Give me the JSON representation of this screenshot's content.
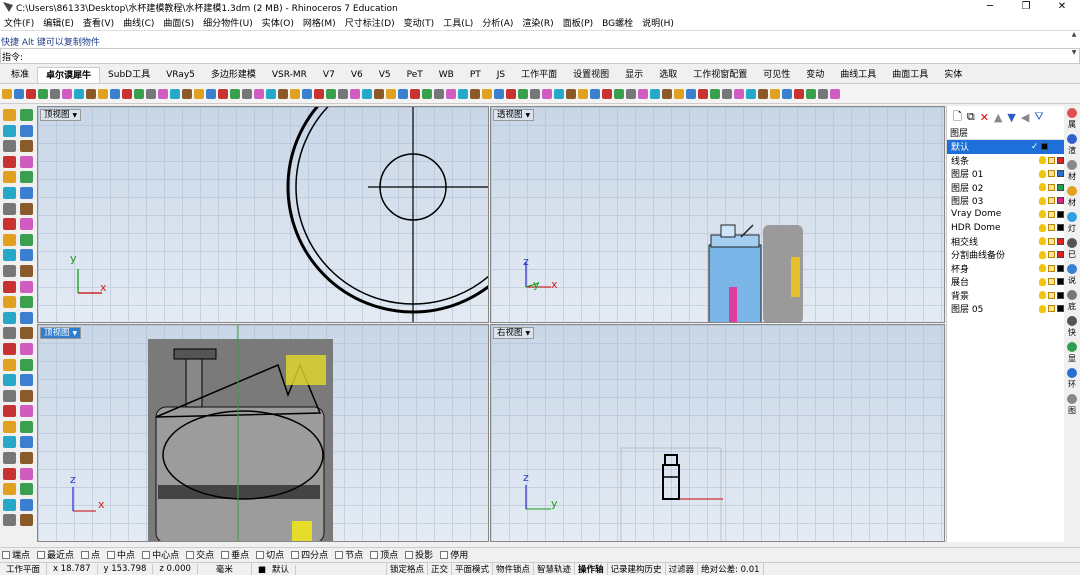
{
  "window": {
    "title": "C:\\Users\\86133\\Desktop\\水杯建模教程\\水杯建模1.3dm (2 MB) - Rhinoceros 7 Education",
    "min": "─",
    "max": "❐",
    "close": "✕"
  },
  "menu": [
    "文件(F)",
    "编辑(E)",
    "查看(V)",
    "曲线(C)",
    "曲面(S)",
    "细分物件(U)",
    "实体(O)",
    "网格(M)",
    "尺寸标注(D)",
    "变动(T)",
    "工具(L)",
    "分析(A)",
    "渲染(R)",
    "面板(P)",
    "BG螺栓",
    "说明(H)"
  ],
  "command": {
    "history": "快捷 Alt 键可以复制物件",
    "prompt": "指令:",
    "value": ""
  },
  "tabs": [
    "标准",
    "卓尔谟犀牛",
    "SubD工具",
    "VRay5",
    "多边形建模",
    "VSR-MR",
    "V7",
    "V6",
    "V5",
    "PeT",
    "WB",
    "PT",
    "JS",
    "工作平面",
    "设置视图",
    "显示",
    "选取",
    "工作视窗配置",
    "可见性",
    "变动",
    "曲线工具",
    "曲面工具",
    "实体"
  ],
  "active_tab": "卓尔谟犀牛",
  "viewports": {
    "top": "顶视图",
    "perspective": "透视图",
    "front": "顶视图",
    "right": "右视图"
  },
  "axes": {
    "x": "x",
    "y": "y",
    "z": "z"
  },
  "layers_panel": {
    "header": "图层",
    "layers": [
      {
        "name": "默认",
        "color": "#000000",
        "current": true,
        "check": "✓"
      },
      {
        "name": "线条",
        "color": "#e02020"
      },
      {
        "name": "图层 01",
        "color": "#2a6fd6"
      },
      {
        "name": "图层 02",
        "color": "#1aa34a"
      },
      {
        "name": "图层 03",
        "color": "#e0208a"
      },
      {
        "name": "Vray Dome",
        "color": "#000000"
      },
      {
        "name": "HDR Dome",
        "color": "#000000"
      },
      {
        "name": "相交线",
        "color": "#e02020"
      },
      {
        "name": "分割曲线备份",
        "color": "#e02020"
      },
      {
        "name": "杯身",
        "color": "#000000"
      },
      {
        "name": "展台",
        "color": "#000000"
      },
      {
        "name": "背景",
        "color": "#000000"
      },
      {
        "name": "图层 05",
        "color": "#000000"
      }
    ]
  },
  "side_tabs": [
    "属",
    "渲",
    "材",
    "材",
    "灯",
    "已",
    "说",
    "底",
    "快",
    "显",
    "环",
    "图"
  ],
  "snaps": [
    "端点",
    "最近点",
    "点",
    "中点",
    "中心点",
    "交点",
    "垂点",
    "切点",
    "四分点",
    "节点",
    "顶点",
    "投影",
    "停用"
  ],
  "status": {
    "cplane": "工作平面",
    "x": "x 18.787",
    "y": "y 153.798",
    "z": "z 0.000",
    "units": "毫米",
    "layer": "默认",
    "items": [
      "锁定格点",
      "正交",
      "平面模式",
      "物件锁点",
      "智慧轨迹",
      "操作轴",
      "记录建构历史",
      "过滤器",
      "绝对公差: 0.01"
    ]
  }
}
